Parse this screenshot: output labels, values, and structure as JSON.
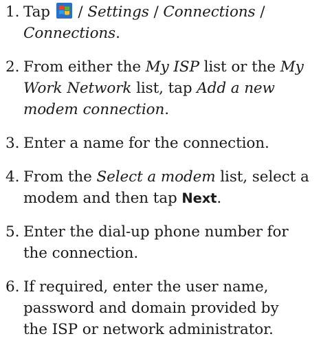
{
  "steps": [
    {
      "number": "1.",
      "tap": "Tap",
      "sep1": "/",
      "settings": "Settings",
      "sep2": "/",
      "connections1": "Connections",
      "sep3": "/",
      "connections2": "Connections",
      "period": ".",
      "icon": "windows-start-icon"
    },
    {
      "number": "2.",
      "a": "From either the",
      "myisp": "My ISP",
      "b": "list or the",
      "my": "My",
      "worknet": "Work Network",
      "c": "list, tap",
      "addnew": "Add a new",
      "modemconn": "modem connection",
      "period": "."
    },
    {
      "number": "3.",
      "text": "Enter a name for the connection."
    },
    {
      "number": "4.",
      "a": "From the",
      "selectmodem": "Select a modem",
      "b": "list, select a",
      "c": "modem and then tap",
      "next": "Next",
      "period": "."
    },
    {
      "number": "5.",
      "line1": "Enter the dial-up phone number for",
      "line2": "the connection."
    },
    {
      "number": "6.",
      "line1": "If required, enter the user name,",
      "line2": "password and domain provided by",
      "line3": "the ISP or network administrator."
    }
  ],
  "colors": {
    "text": "#1a1a1a",
    "icon_red": "#e8422c",
    "icon_green": "#5fb22e",
    "icon_blue": "#2d7fd6",
    "icon_yellow": "#f5c22b",
    "icon_bg": "#2a6fc9"
  }
}
